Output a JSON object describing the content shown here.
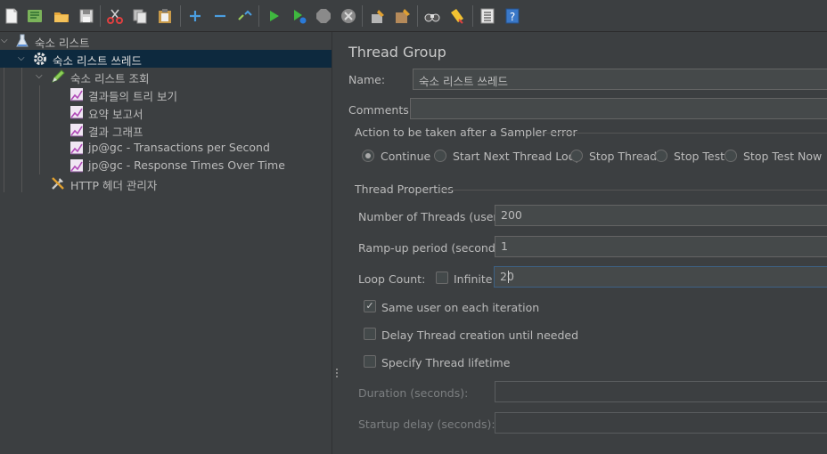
{
  "toolbar": {
    "icons": [
      "new-icon",
      "templates-icon",
      "open-icon",
      "save-icon",
      "cut-icon",
      "copy-icon",
      "paste-icon",
      "expand-icon",
      "collapse-icon",
      "toggle-icon",
      "start-icon",
      "start-no-pause-icon",
      "stop-icon",
      "shutdown-icon",
      "clear-icon",
      "clear-all-icon",
      "search-icon",
      "reset-search-icon",
      "function-helper-icon",
      "help-icon"
    ]
  },
  "tree": {
    "items": [
      {
        "label": "숙소 리스트",
        "icon": "test-plan-icon"
      },
      {
        "label": "숙소 리스트 쓰레드",
        "icon": "gear-icon"
      },
      {
        "label": "숙소 리스트 조회",
        "icon": "sampler-pen-icon"
      },
      {
        "label": "결과들의 트리 보기",
        "icon": "listener-graph-icon"
      },
      {
        "label": "요약 보고서",
        "icon": "listener-graph-icon"
      },
      {
        "label": "결과 그래프",
        "icon": "listener-graph-icon"
      },
      {
        "label": "jp@gc - Transactions per Second",
        "icon": "listener-graph-icon"
      },
      {
        "label": "jp@gc - Response Times Over Time",
        "icon": "listener-graph-icon"
      },
      {
        "label": "HTTP 헤더 관리자",
        "icon": "config-tools-icon"
      }
    ]
  },
  "panel": {
    "title": "Thread Group",
    "name_label": "Name:",
    "name_value": "숙소 리스트 쓰레드",
    "comments_label": "Comments:",
    "comments_value": "",
    "action_group_label": "Action to be taken after a Sampler error",
    "actions": [
      {
        "label": "Continue",
        "selected": true
      },
      {
        "label": "Start Next Thread Loop",
        "selected": false
      },
      {
        "label": "Stop Thread",
        "selected": false
      },
      {
        "label": "Stop Test",
        "selected": false
      },
      {
        "label": "Stop Test Now",
        "selected": false
      }
    ],
    "props_group_label": "Thread Properties",
    "threads_label": "Number of Threads (users):",
    "threads_value": "200",
    "rampup_label": "Ramp-up period (seconds):",
    "rampup_value": "1",
    "loop_label": "Loop Count:",
    "infinite_label": "Infinite",
    "infinite_checked": false,
    "loop_value": "20",
    "same_user_label": "Same user on each iteration",
    "same_user_checked": true,
    "delay_label": "Delay Thread creation until needed",
    "delay_checked": false,
    "lifetime_label": "Specify Thread lifetime",
    "lifetime_checked": false,
    "duration_label": "Duration (seconds):",
    "duration_value": "",
    "startup_label": "Startup delay (seconds):",
    "startup_value": ""
  }
}
